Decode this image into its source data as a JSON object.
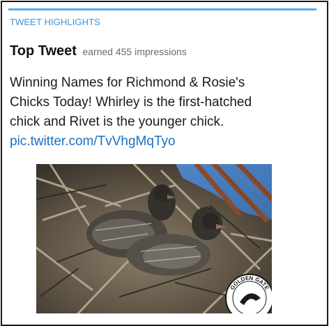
{
  "card": {
    "section_label": "TWEET HIGHLIGHTS",
    "title": "Top Tweet",
    "subtitle": "earned 455 impressions"
  },
  "tweet": {
    "lines": [
      "Winning Names for Richmond & Rosie's",
      "Chicks Today!  Whirley is the first-hatched",
      "chick and Rivet is the younger chick."
    ],
    "link": "pic.twitter.com/TvVhgMqTyo"
  },
  "photo": {
    "logo_text": "GOLDEN GATE"
  },
  "colors": {
    "accent_bar": "#55acee",
    "section_label": "#3b94d9",
    "link": "#1b6fc0"
  }
}
